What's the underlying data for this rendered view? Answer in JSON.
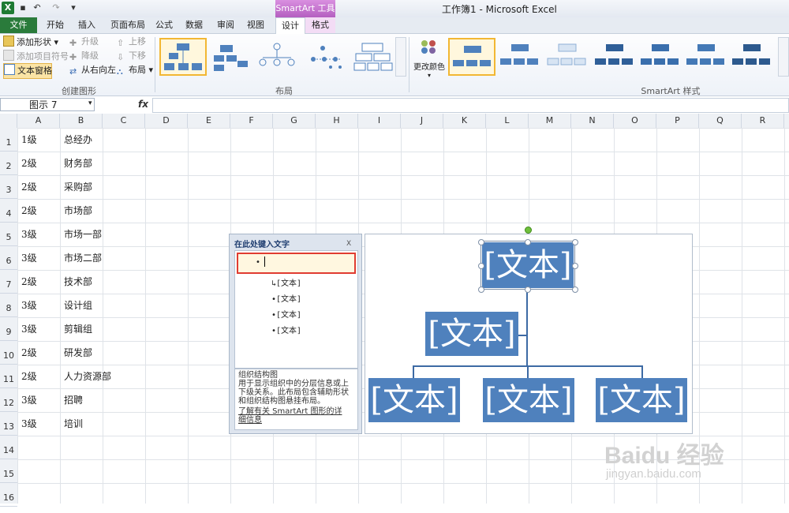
{
  "window": {
    "title": "工作簿1 - Microsoft Excel",
    "context_tool": "SmartArt 工具"
  },
  "tabs": [
    "文件",
    "开始",
    "插入",
    "页面布局",
    "公式",
    "数据",
    "审阅",
    "视图",
    "设计",
    "格式"
  ],
  "ribbon": {
    "create_graphic": {
      "label": "创建图形",
      "add_shape": "添加形状 ▾",
      "add_bullet": "添加项目符号",
      "text_pane": "文本窗格",
      "promote": "升级",
      "demote": "降级",
      "right_to_left": "从右向左",
      "move_up": "上移",
      "move_down": "下移",
      "layout": "布局 ▾"
    },
    "layouts": {
      "label": "布局"
    },
    "styles": {
      "label": "SmartArt 样式",
      "change_colors": "更改颜色"
    }
  },
  "formula_bar": {
    "name_box": "图示 7",
    "fx": "fx"
  },
  "columns": [
    "A",
    "B",
    "C",
    "D",
    "E",
    "F",
    "G",
    "H",
    "I",
    "J",
    "K",
    "L",
    "M",
    "N",
    "O",
    "P",
    "Q",
    "R"
  ],
  "rows": [
    "1",
    "2",
    "3",
    "4",
    "5",
    "6",
    "7",
    "8",
    "9",
    "10",
    "11",
    "12",
    "13",
    "14",
    "15",
    "16"
  ],
  "cells": [
    {
      "a": "1级",
      "b": "总经办"
    },
    {
      "a": "2级",
      "b": "财务部"
    },
    {
      "a": "2级",
      "b": "采购部"
    },
    {
      "a": "2级",
      "b": "市场部"
    },
    {
      "a": "3级",
      "b": "市场一部"
    },
    {
      "a": "3级",
      "b": "市场二部"
    },
    {
      "a": "2级",
      "b": "技术部"
    },
    {
      "a": "3级",
      "b": "设计组"
    },
    {
      "a": "3级",
      "b": "剪辑组"
    },
    {
      "a": "2级",
      "b": "研发部"
    },
    {
      "a": "2级",
      "b": "人力资源部"
    },
    {
      "a": "3级",
      "b": "招聘"
    },
    {
      "a": "3级",
      "b": "培训"
    }
  ],
  "text_pane": {
    "title": "在此处键入文字",
    "close": "X",
    "items": [
      "[文本]",
      "[文本]",
      "[文本]",
      "[文本]"
    ],
    "desc_title": "组织结构图",
    "desc_lines": [
      "用于显示组织中的分层信息或上",
      "下级关系。此布局包含辅助形状",
      "和组织结构图悬挂布局。"
    ],
    "link_lines": [
      "了解有关 SmartArt 图形的详",
      "细信息"
    ]
  },
  "smartart": {
    "placeholder": "[文本]"
  },
  "watermark": {
    "brand": "Baidu 经验",
    "url": "jingyan.baidu.com"
  }
}
